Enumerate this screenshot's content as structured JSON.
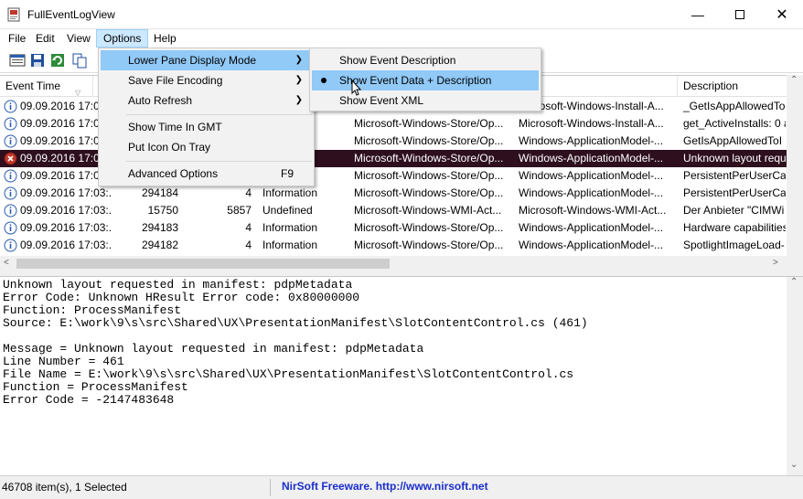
{
  "window": {
    "title": "FullEventLogView"
  },
  "menubar": [
    "File",
    "Edit",
    "View",
    "Options",
    "Help"
  ],
  "options_menu": {
    "items": [
      {
        "label": "Lower Pane Display Mode",
        "submenu": true
      },
      {
        "label": "Save File Encoding",
        "submenu": true
      },
      {
        "label": "Auto Refresh",
        "submenu": true
      },
      {
        "label": "Show Time In GMT"
      },
      {
        "label": "Put Icon On Tray"
      },
      {
        "label": "Advanced Options",
        "shortcut": "F9"
      }
    ]
  },
  "submenu": {
    "items": [
      {
        "label": "Show Event Description"
      },
      {
        "label": "Show Event  Data + Description",
        "checked": true
      },
      {
        "label": "Show Event XML"
      }
    ]
  },
  "list": {
    "headers": [
      "Event Time",
      "",
      "",
      "",
      "",
      "ider",
      "Description"
    ],
    "rows": [
      {
        "icon": "info",
        "time": "09.09.2016 17:03",
        "id": "",
        "task": "",
        "level": "",
        "channel": "",
        "provider": "Microsoft-Windows-Install-A...",
        "desc": "_GetIsAppAllowedTo"
      },
      {
        "icon": "info",
        "time": "09.09.2016 17:03",
        "id": "",
        "task": "",
        "level": "n",
        "channel": "Microsoft-Windows-Store/Op...",
        "provider": "Microsoft-Windows-Install-A...",
        "desc": "get_ActiveInstalls: 0 a"
      },
      {
        "icon": "info",
        "time": "09.09.2016 17:03",
        "id": "",
        "task": "",
        "level": "n",
        "channel": "Microsoft-Windows-Store/Op...",
        "provider": "Windows-ApplicationModel-...",
        "desc": "GetIsAppAllowedToI"
      },
      {
        "icon": "error",
        "time": "09.09.2016 17:03",
        "id": "",
        "task": "",
        "level": "",
        "channel": "Microsoft-Windows-Store/Op...",
        "provider": "Windows-ApplicationModel-...",
        "desc": "Unknown layout requ",
        "selected": true
      },
      {
        "icon": "info",
        "time": "09.09.2016 17:03",
        "id": "",
        "task": "",
        "level": "n",
        "channel": "Microsoft-Windows-Store/Op...",
        "provider": "Windows-ApplicationModel-...",
        "desc": "PersistentPerUserCac"
      },
      {
        "icon": "info",
        "time": "09.09.2016 17:03:...",
        "id": "294184",
        "task": "4",
        "level": "Information",
        "channel": "Microsoft-Windows-Store/Op...",
        "provider": "Windows-ApplicationModel-...",
        "desc": "PersistentPerUserCac"
      },
      {
        "icon": "info",
        "time": "09.09.2016 17:03:...",
        "id": "15750",
        "task": "5857",
        "level": "Undefined",
        "channel": "Microsoft-Windows-WMI-Act...",
        "provider": "Microsoft-Windows-WMI-Act...",
        "desc": "Der Anbieter \"CIMWi"
      },
      {
        "icon": "info",
        "time": "09.09.2016 17:03:...",
        "id": "294183",
        "task": "4",
        "level": "Information",
        "channel": "Microsoft-Windows-Store/Op...",
        "provider": "Windows-ApplicationModel-...",
        "desc": "Hardware capabilities"
      },
      {
        "icon": "info",
        "time": "09.09.2016 17:03:...",
        "id": "294182",
        "task": "4",
        "level": "Information",
        "channel": "Microsoft-Windows-Store/Op...",
        "provider": "Windows-ApplicationModel-...",
        "desc": "SpotlightImageLoad-"
      }
    ]
  },
  "lower_pane": {
    "lines": [
      "Unknown layout requested in manifest: pdpMetadata",
      "Error Code: Unknown HResult Error code: 0x80000000",
      "Function: ProcessManifest",
      "Source: E:\\work\\9\\s\\src\\Shared\\UX\\PresentationManifest\\SlotContentControl.cs (461)",
      "",
      "Message = Unknown layout requested in manifest: pdpMetadata",
      "Line Number = 461",
      "File Name = E:\\work\\9\\s\\src\\Shared\\UX\\PresentationManifest\\SlotContentControl.cs",
      "Function = ProcessManifest",
      "Error Code = -2147483648"
    ]
  },
  "statusbar": {
    "count": "46708 item(s), 1 Selected",
    "credit": "NirSoft Freeware.  http://www.nirsoft.net"
  }
}
